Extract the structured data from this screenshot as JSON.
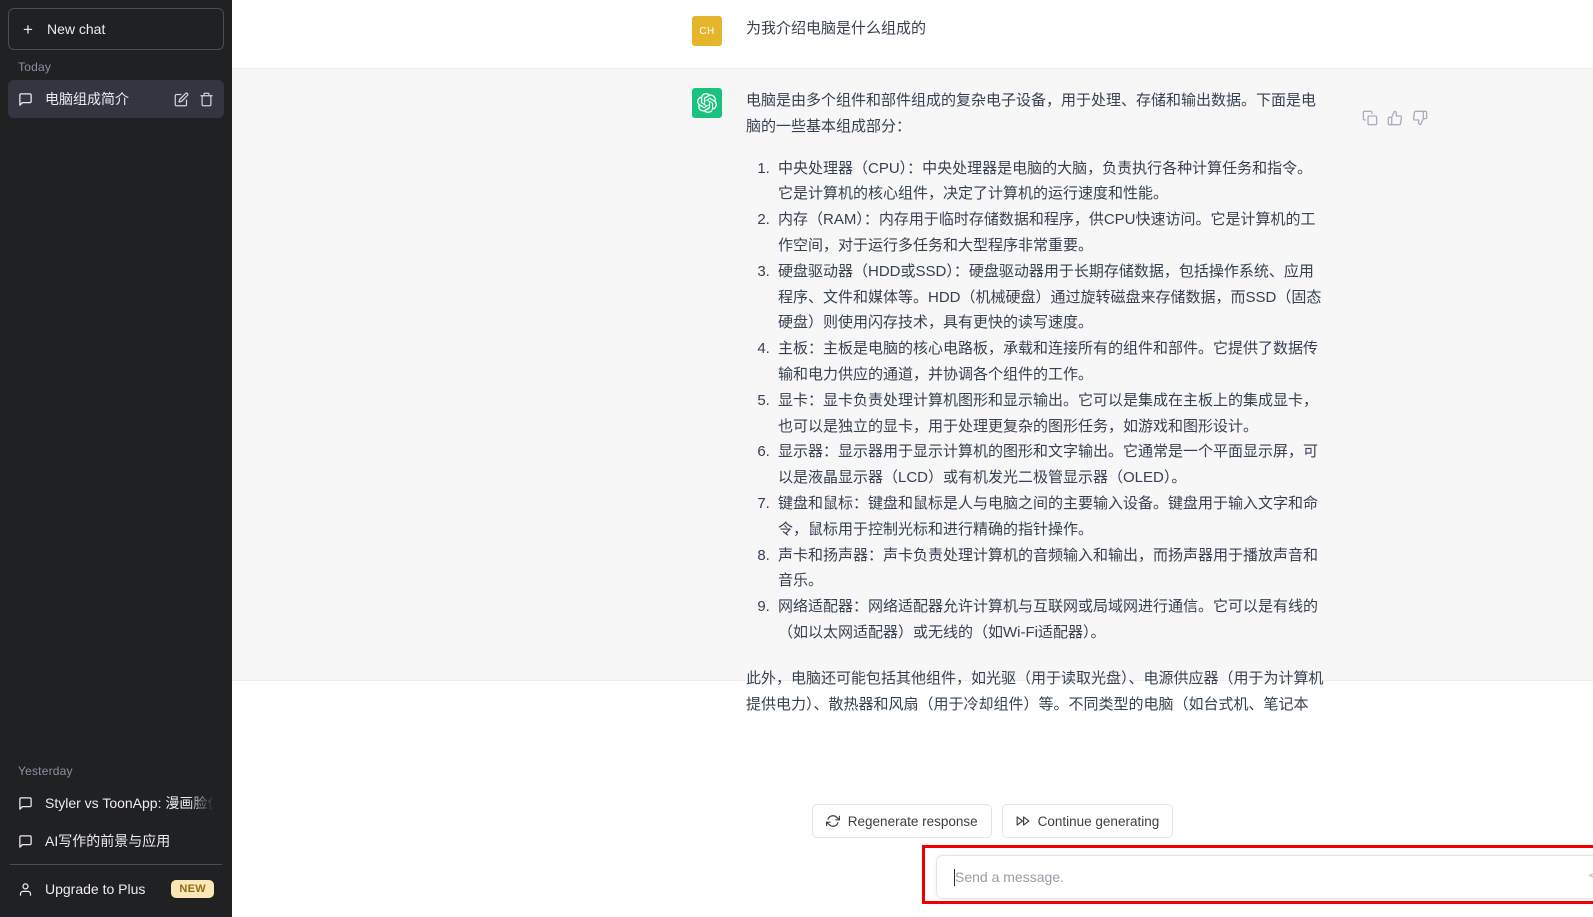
{
  "sidebar": {
    "new_chat_label": "New chat",
    "today_label": "Today",
    "yesterday_label": "Yesterday",
    "today_items": [
      {
        "title": "电脑组成简介",
        "icon": "message-icon",
        "active": true
      }
    ],
    "yesterday_items": [
      {
        "title": "Styler vs ToonApp: 漫画脸优势",
        "icon": "message-icon"
      },
      {
        "title": "AI写作的前景与应用",
        "icon": "message-icon"
      }
    ],
    "upgrade": {
      "label": "Upgrade to Plus",
      "badge": "NEW",
      "icon": "person-icon",
      "badge_bg": "#f9e8b6",
      "badge_color": "#8b6e1a"
    },
    "bg_color": "#202123",
    "active_bg_color": "#343541"
  },
  "messages": [
    {
      "role": "user",
      "avatar_text": "CH",
      "avatar_color": "#e5b62b",
      "text": "为我介绍电脑是什么组成的"
    },
    {
      "role": "assistant",
      "avatar_color": "#19c37d",
      "avatar_icon": "openai-logo-icon",
      "intro": "电脑是由多个组件和部件组成的复杂电子设备，用于处理、存储和输出数据。下面是电脑的一些基本组成部分：",
      "list": [
        "中央处理器（CPU）：中央处理器是电脑的大脑，负责执行各种计算任务和指令。它是计算机的核心组件，决定了计算机的运行速度和性能。",
        "内存（RAM）：内存用于临时存储数据和程序，供CPU快速访问。它是计算机的工作空间，对于运行多任务和大型程序非常重要。",
        "硬盘驱动器（HDD或SSD）：硬盘驱动器用于长期存储数据，包括操作系统、应用程序、文件和媒体等。HDD（机械硬盘）通过旋转磁盘来存储数据，而SSD（固态硬盘）则使用闪存技术，具有更快的读写速度。",
        "主板：主板是电脑的核心电路板，承载和连接所有的组件和部件。它提供了数据传输和电力供应的通道，并协调各个组件的工作。",
        "显卡：显卡负责处理计算机图形和显示输出。它可以是集成在主板上的集成显卡，也可以是独立的显卡，用于处理更复杂的图形任务，如游戏和图形设计。",
        "显示器：显示器用于显示计算机的图形和文字输出。它通常是一个平面显示屏，可以是液晶显示器（LCD）或有机发光二极管显示器（OLED）。",
        "键盘和鼠标：键盘和鼠标是人与电脑之间的主要输入设备。键盘用于输入文字和命令，鼠标用于控制光标和进行精确的指针操作。",
        "声卡和扬声器：声卡负责处理计算机的音频输入和输出，而扬声器用于播放声音和音乐。",
        "网络适配器：网络适配器允许计算机与互联网或局域网进行通信。它可以是有线的（如以太网适配器）或无线的（如Wi-Fi适配器）。"
      ],
      "tail": "此外，电脑还可能包括其他组件，如光驱（用于读取光盘）、电源供应器（用于为计算机提供电力）、散热器和风扇（用于冷却组件）等。不同类型的电脑（如台式机、笔记本",
      "actions": [
        {
          "name": "copy-icon",
          "label": "Copy"
        },
        {
          "name": "thumbs-up-icon",
          "label": "Good response"
        },
        {
          "name": "thumbs-down-icon",
          "label": "Bad response"
        }
      ]
    }
  ],
  "composer": {
    "regenerate_label": "Regenerate response",
    "continue_label": "Continue generating",
    "placeholder": "Send a message.",
    "value": "",
    "highlight_color": "#ee0000",
    "send_icon": "send-icon"
  }
}
